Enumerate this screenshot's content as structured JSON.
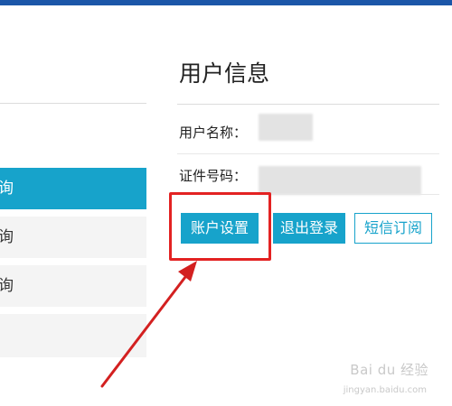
{
  "sidebar": {
    "items": [
      {
        "label": "询",
        "active": true
      },
      {
        "label": "询",
        "active": false
      },
      {
        "label": "询",
        "active": false
      },
      {
        "label": "",
        "active": false
      }
    ]
  },
  "panel": {
    "title": "用户信息",
    "fields": [
      {
        "label": "用户名称："
      },
      {
        "label": "证件号码："
      }
    ]
  },
  "buttons": {
    "account_settings": "账户设置",
    "logout": "退出登录",
    "sms_subscription": "短信订阅"
  },
  "watermark": {
    "brand": "Bai du 经验",
    "url": "jingyan.baidu.com"
  },
  "colors": {
    "accent": "#17a3cb",
    "top_bar": "#1b56a8",
    "highlight": "#e32222"
  }
}
